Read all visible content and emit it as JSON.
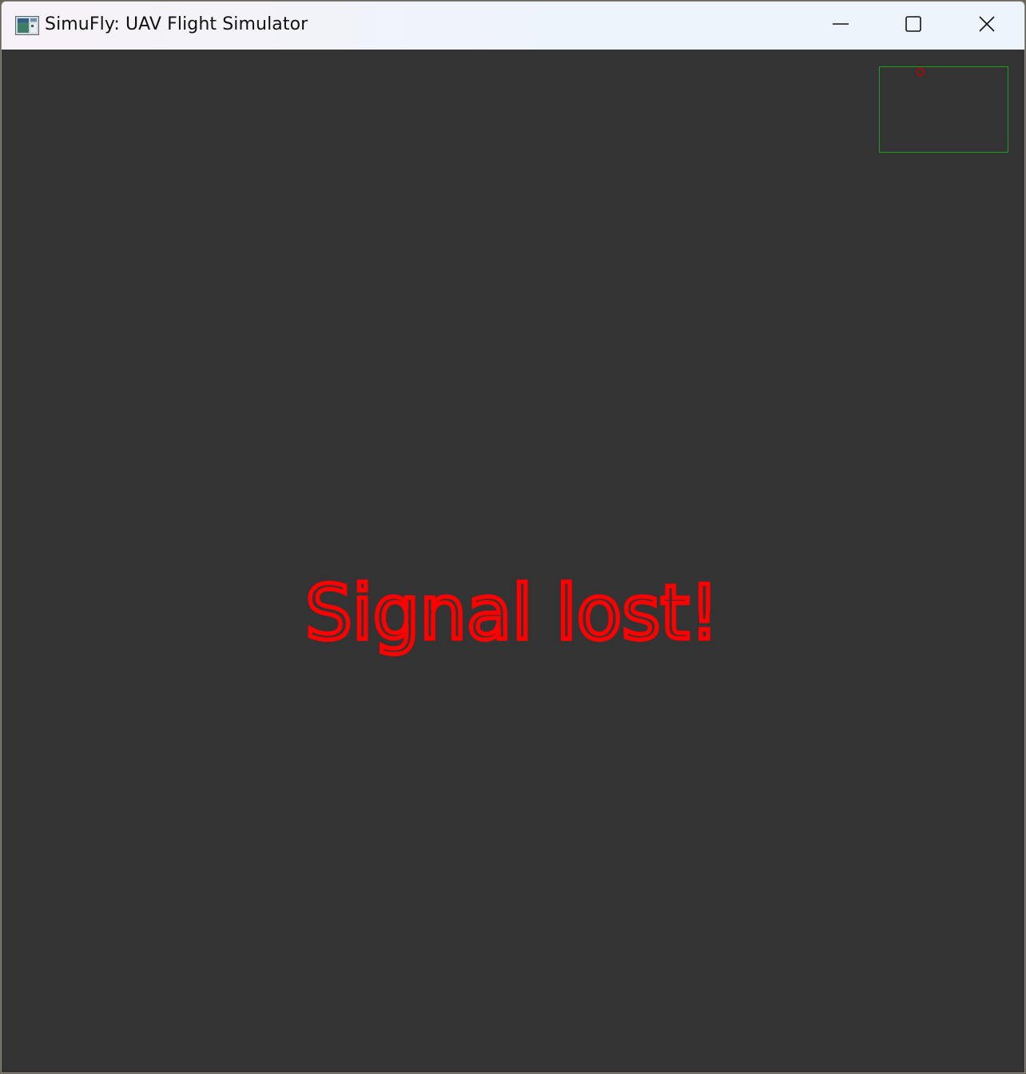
{
  "window": {
    "title": "SimuFly: UAV Flight Simulator",
    "app_icon": "app-window-icon",
    "controls": {
      "minimize_icon": "minimize-icon",
      "maximize_icon": "maximize-icon",
      "close_icon": "close-icon"
    }
  },
  "viewport": {
    "status_message": "Signal lost!",
    "status_color": "#ff0000",
    "background_color": "#333333"
  },
  "minimap": {
    "border_color": "#1aa01a",
    "marker_icon": "uav-position-marker-icon",
    "marker_color": "#c40000"
  }
}
